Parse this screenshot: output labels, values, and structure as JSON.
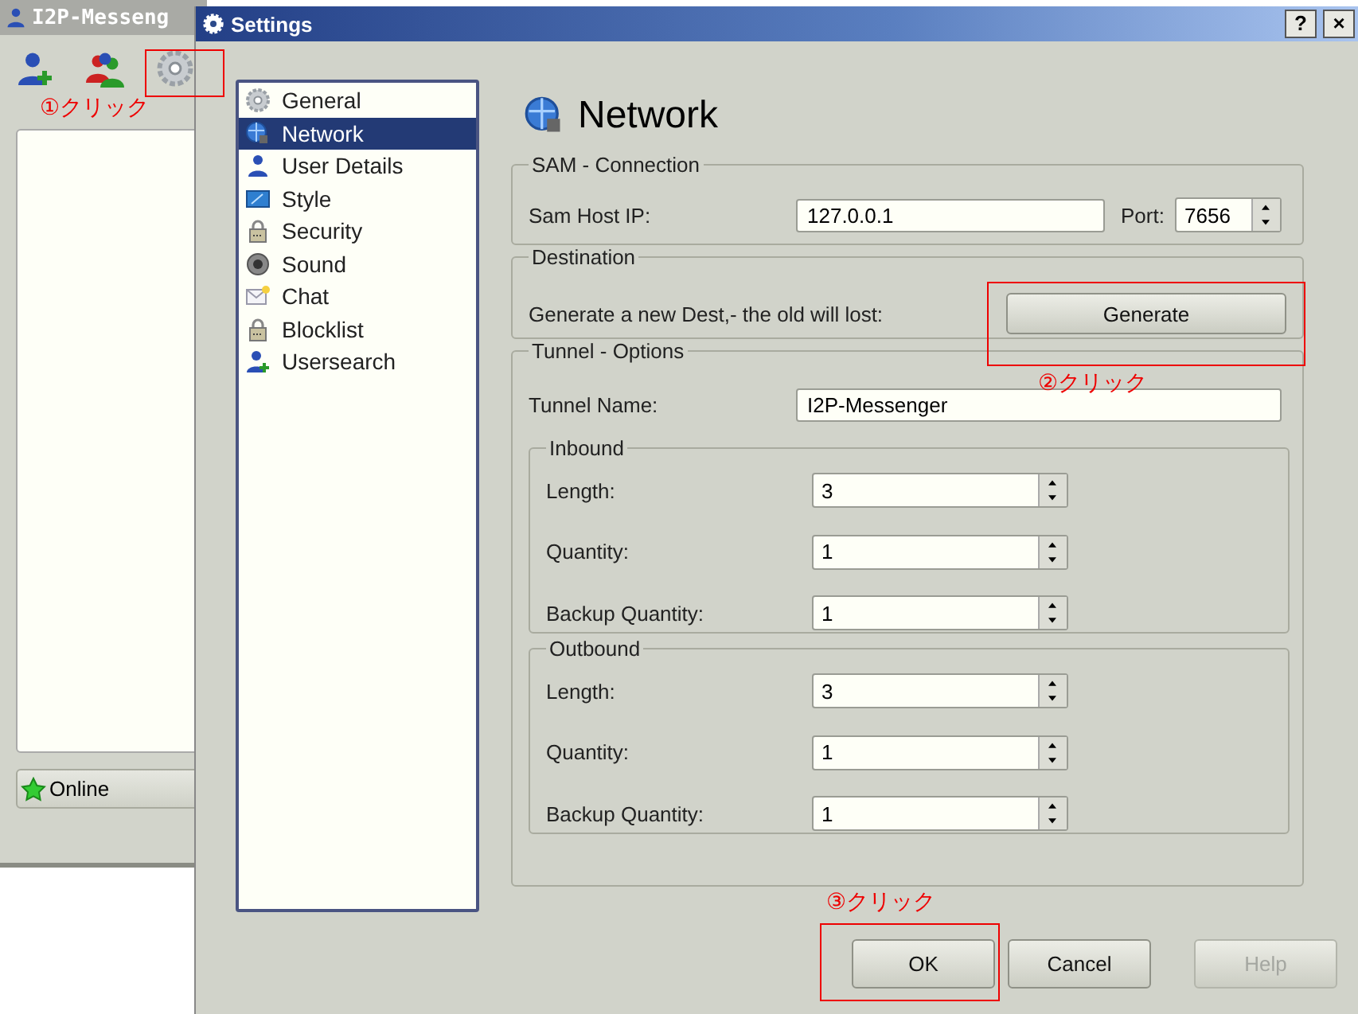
{
  "background_window": {
    "title": "I2P-Messeng",
    "status_button": "Online"
  },
  "dialog": {
    "title": "Settings",
    "help_button": "?",
    "close_button": "×"
  },
  "sidebar": {
    "items": [
      {
        "label": "General",
        "kind": "gear",
        "selected": false
      },
      {
        "label": "Network",
        "kind": "globe",
        "selected": true
      },
      {
        "label": "User Details",
        "kind": "user",
        "selected": false
      },
      {
        "label": "Style",
        "kind": "monitor",
        "selected": false
      },
      {
        "label": "Security",
        "kind": "lock",
        "selected": false
      },
      {
        "label": "Sound",
        "kind": "speaker",
        "selected": false
      },
      {
        "label": "Chat",
        "kind": "mail",
        "selected": false
      },
      {
        "label": "Blocklist",
        "kind": "lock",
        "selected": false
      },
      {
        "label": "Usersearch",
        "kind": "useradd",
        "selected": false
      }
    ]
  },
  "page": {
    "title": "Network"
  },
  "sam": {
    "legend": "SAM - Connection",
    "host_label": "Sam Host IP:",
    "host_value": "127.0.0.1",
    "port_label": "Port:",
    "port_value": "7656"
  },
  "destination": {
    "legend": "Destination",
    "text": "Generate a new Dest,- the old will lost:",
    "button": "Generate"
  },
  "tunnel": {
    "legend": "Tunnel - Options",
    "name_label": "Tunnel Name:",
    "name_value": "I2P-Messenger",
    "groups": [
      {
        "legend": "Inbound",
        "rows": [
          {
            "label": "Length:",
            "value": "3"
          },
          {
            "label": "Quantity:",
            "value": "1"
          },
          {
            "label": "Backup Quantity:",
            "value": "1"
          }
        ]
      },
      {
        "legend": "Outbound",
        "rows": [
          {
            "label": "Length:",
            "value": "3"
          },
          {
            "label": "Quantity:",
            "value": "1"
          },
          {
            "label": "Backup Quantity:",
            "value": "1"
          }
        ]
      }
    ]
  },
  "buttons": [
    {
      "label": "OK",
      "disabled": false
    },
    {
      "label": "Cancel",
      "disabled": false
    },
    {
      "label": "Help",
      "disabled": true
    }
  ],
  "annotations": [
    {
      "text": "①クリック"
    },
    {
      "text": "②クリック"
    },
    {
      "text": "③クリック"
    }
  ]
}
